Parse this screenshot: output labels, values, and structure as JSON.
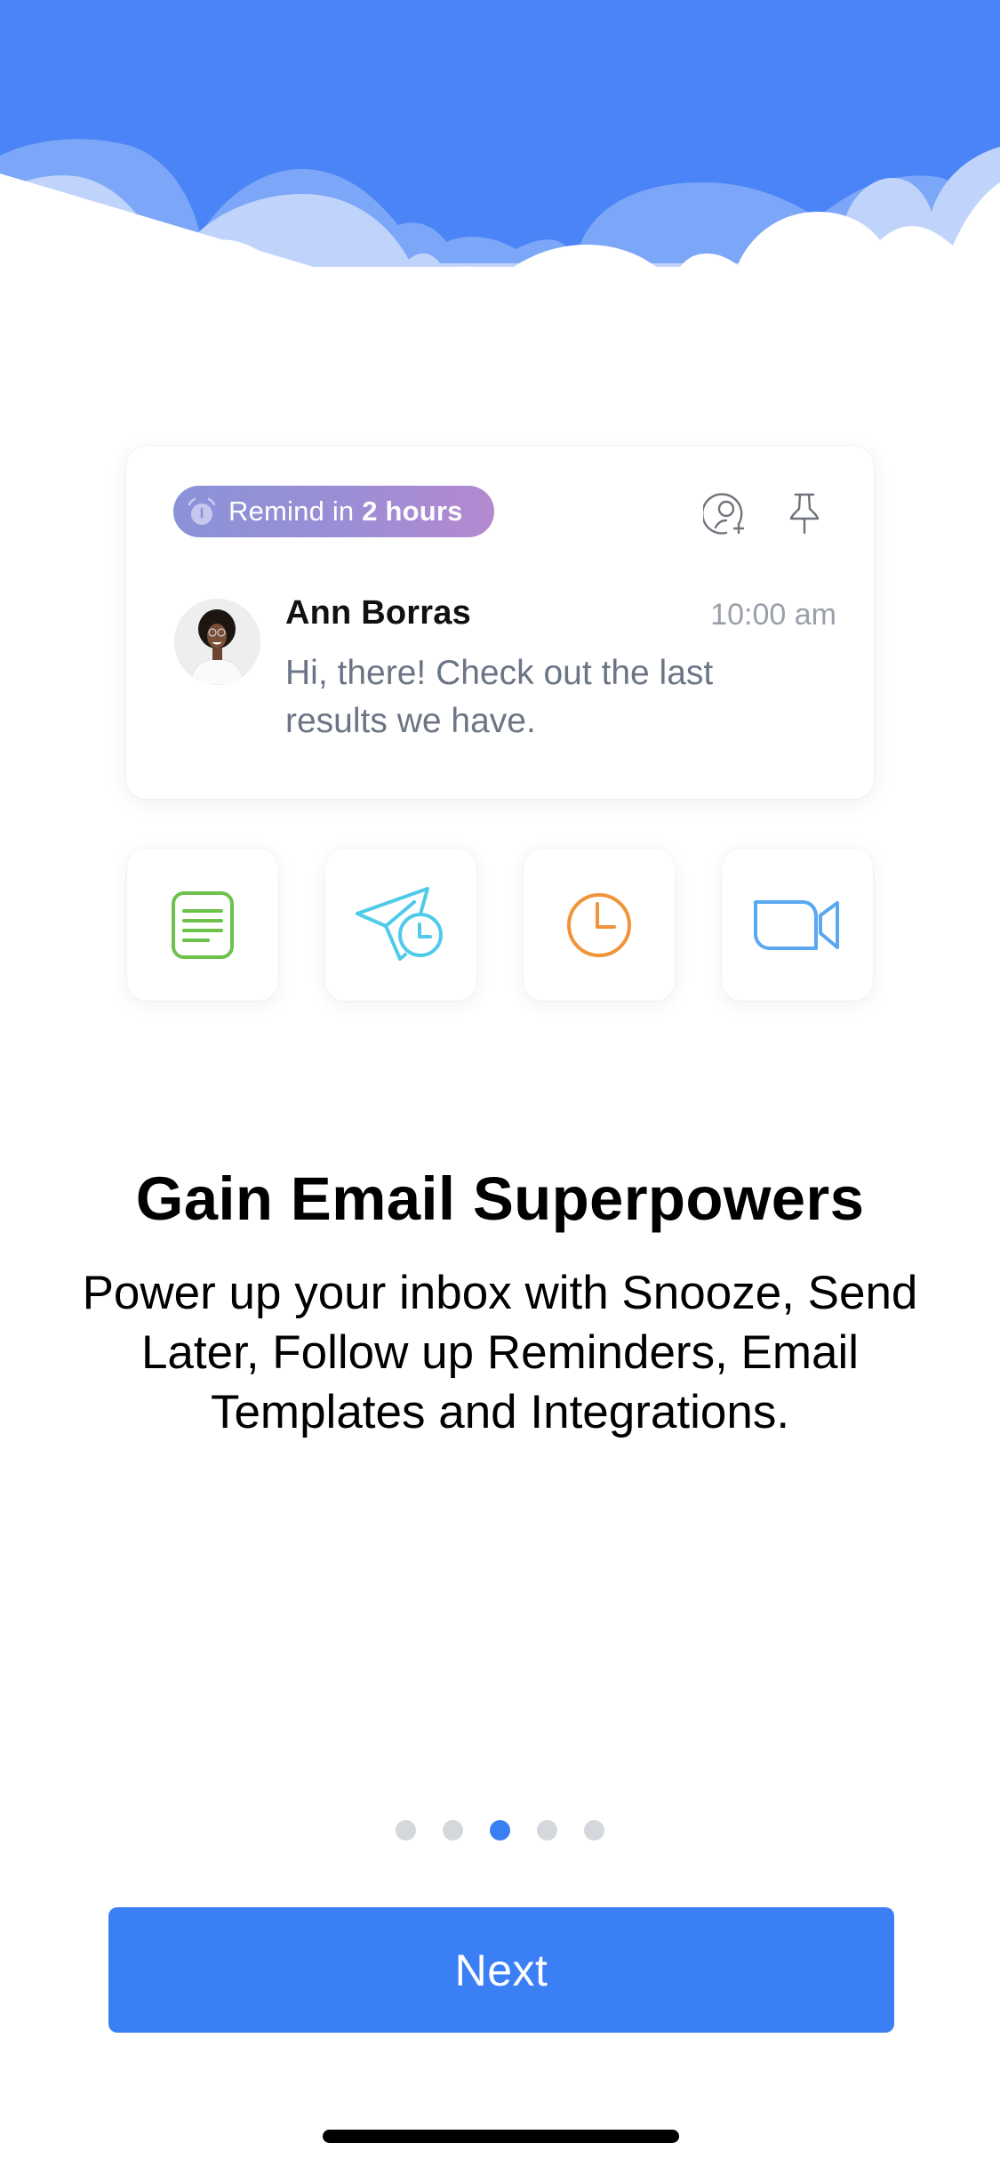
{
  "header": {
    "illustration": "clouds-banner",
    "colors": {
      "sky": "#4a84f6",
      "cloud_back": "#7ca6f7",
      "cloud_mid": "#c0d4fb",
      "cloud_front": "#ffffff"
    }
  },
  "email_card": {
    "reminder": {
      "icon": "alarm-icon",
      "prefix": "Remind in ",
      "emphasis": "2 hours"
    },
    "actions": [
      {
        "name": "add-contact",
        "icon": "user-plus-icon"
      },
      {
        "name": "pin",
        "icon": "pin-icon"
      }
    ],
    "avatar": "avatar-ann-borras",
    "sender": "Ann Borras",
    "time": "10:00 am",
    "preview": "Hi, there! Check out the last results we have."
  },
  "feature_tiles": [
    {
      "name": "email-templates",
      "icon": "document-icon",
      "color": "#6cc24a"
    },
    {
      "name": "send-later",
      "icon": "paper-plane-clock-icon",
      "color": "#4fcbea"
    },
    {
      "name": "snooze",
      "icon": "clock-icon",
      "color": "#f0943a"
    },
    {
      "name": "integrations",
      "icon": "video-camera-icon",
      "color": "#5aa7f2"
    }
  ],
  "onboarding": {
    "title": "Gain Email Superpowers",
    "description": "Power up your inbox with Snooze, Send Later, Follow up Reminders, Email Templates and Integrations."
  },
  "pagination": {
    "total_pages": 5,
    "current_page": 3,
    "active_color": "#3b7ff5",
    "inactive_color": "#d4d7dc"
  },
  "footer": {
    "next_label": "Next",
    "button_color": "#3b7ff5"
  }
}
